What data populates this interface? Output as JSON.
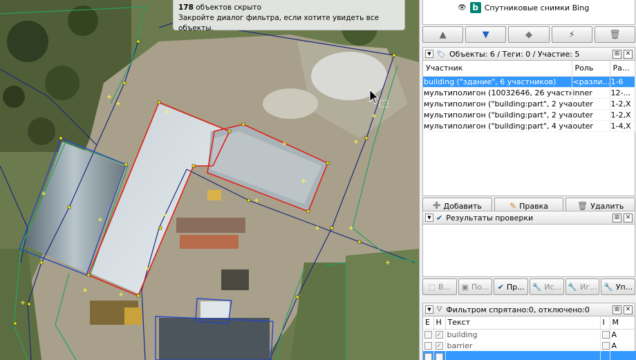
{
  "map": {
    "tooltip": {
      "count": "178",
      "line1_rest": " объектов скрыто",
      "line2": "Закройте диалог фильтра, если хотите увидеть все объекты."
    }
  },
  "layers": {
    "item_label": "Спутниковые снимки Bing",
    "buttons": [
      "move-up",
      "move-down",
      "merge",
      "visibility",
      "delete"
    ]
  },
  "relation": {
    "title": "Объекты: 6 / Теги: 0 / Участие: 5",
    "columns": [
      "Участник",
      "Роль",
      "Ра..."
    ],
    "rows": [
      {
        "member": "building (\"здание\", 6 участников)",
        "role": "<разли...",
        "range": "1-6",
        "selected": true
      },
      {
        "member": "мультиполигон (10032646, 26 участни...",
        "role": "inner",
        "range": "12-...",
        "selected": false
      },
      {
        "member": "мультиполигон (\"building:part\", 2 участ...",
        "role": "outer",
        "range": "1-2,X",
        "selected": false
      },
      {
        "member": "мультиполигон (\"building:part\", 2 участ...",
        "role": "outer",
        "range": "1-2,X",
        "selected": false
      },
      {
        "member": "мультиполигон (\"building:part\", 4 участ...",
        "role": "outer",
        "range": "1-4,X",
        "selected": false
      }
    ],
    "buttons": {
      "add": "Добавить",
      "edit": "Правка",
      "delete": "Удалить"
    }
  },
  "validation": {
    "title": "Результаты проверки",
    "buttons": [
      "В...",
      "По...",
      "Пр...",
      "Ис...",
      "Иг...",
      "Уп..."
    ]
  },
  "filter": {
    "title": "Фильтром спрятано:0, отключено:0",
    "columns": [
      "E",
      "H",
      "Текст",
      "I",
      "M"
    ],
    "rows": [
      {
        "text": "building",
        "mode": "A"
      },
      {
        "text": "barrier",
        "mode": "A"
      }
    ]
  },
  "colors": {
    "selection": "#3399ff",
    "bing": "#008373"
  }
}
